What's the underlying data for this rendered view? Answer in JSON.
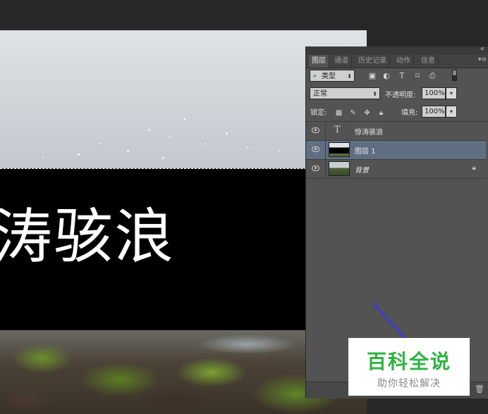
{
  "canvas": {
    "text": "涛骇浪"
  },
  "panel": {
    "tabs": [
      "图层",
      "通道",
      "历史记录",
      "动作",
      "信息"
    ],
    "active_tab": "图层",
    "filter_kind": "类型",
    "blend_mode": "正常",
    "opacity_label": "不透明度:",
    "opacity_value": "100%",
    "lock_label": "锁定:",
    "fill_label": "填充:",
    "fill_value": "100%",
    "layers": [
      {
        "name": "惊涛骇浪",
        "kind": "text",
        "selected": false
      },
      {
        "name": "图层 1",
        "kind": "pixel",
        "selected": true
      },
      {
        "name": "背景",
        "kind": "background",
        "selected": false,
        "locked": true
      }
    ]
  },
  "watermark": {
    "title": "百科全说",
    "subtitle": "助你轻松解决"
  },
  "colors": {
    "app_background": "#282828",
    "panel_background": "#535353",
    "selected_layer": "#5f6e80",
    "watermark_green": "#2db341",
    "annotation_arrow": "#3b3bd8"
  }
}
